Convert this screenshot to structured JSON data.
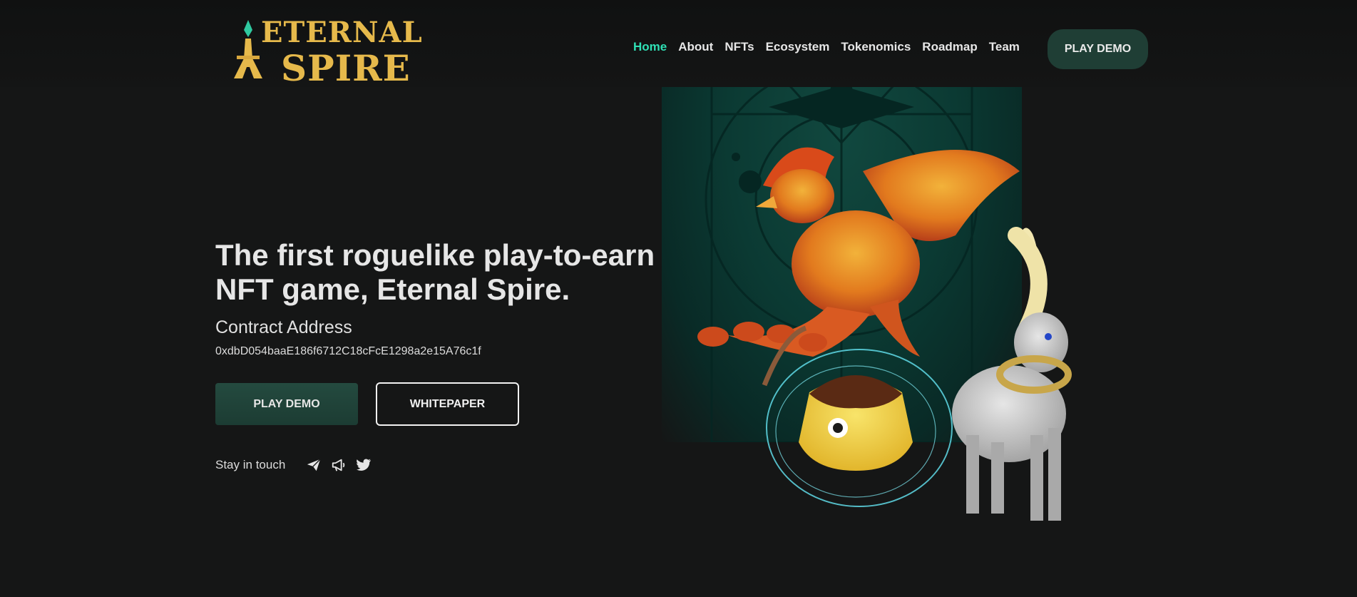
{
  "brand": {
    "logo_line1": "ETERNAL",
    "logo_line2": "SPIRE",
    "logo_color": "#e6b94b"
  },
  "nav": {
    "items": [
      {
        "label": "Home",
        "active": true
      },
      {
        "label": "About"
      },
      {
        "label": "NFTs"
      },
      {
        "label": "Ecosystem"
      },
      {
        "label": "Tokenomics"
      },
      {
        "label": "Roadmap"
      },
      {
        "label": "Team"
      }
    ],
    "cta_label": "PLAY DEMO",
    "active_color": "#2fe0b5"
  },
  "hero": {
    "title": "The first roguelike play-to-earn NFT game, Eternal Spire.",
    "contract_label": "Contract Address",
    "contract_address": "0xdbD054baaE186f6712C18cFcE1298a2e15A76c1f",
    "primary_button": "PLAY DEMO",
    "secondary_button": "WHITEPAPER"
  },
  "social": {
    "label": "Stay in touch",
    "icons": [
      "telegram-icon",
      "megaphone-icon",
      "twitter-icon"
    ]
  },
  "colors": {
    "background": "#151616",
    "accent_green": "#1f3e35",
    "art_panel": "#0b3a33"
  }
}
